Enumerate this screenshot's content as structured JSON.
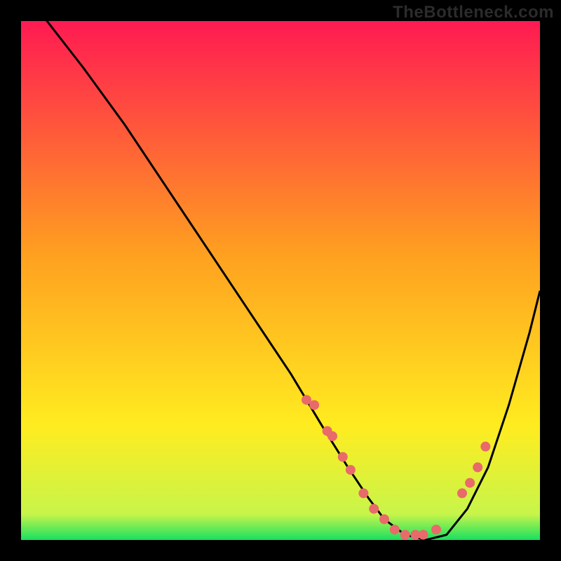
{
  "watermark": "TheBottleneck.com",
  "colors": {
    "frame": "#000000",
    "gradient_top": "#ff1a52",
    "gradient_mid_upper": "#ffa020",
    "gradient_mid_lower": "#ffec20",
    "gradient_green": "#18e060",
    "curve": "#000000",
    "marker": "#e86a6a"
  },
  "chart_data": {
    "type": "line",
    "title": "",
    "xlabel": "",
    "ylabel": "",
    "xlim": [
      0,
      100
    ],
    "ylim": [
      0,
      100
    ],
    "curve": {
      "x": [
        0,
        5,
        12,
        20,
        28,
        36,
        44,
        52,
        58,
        63,
        67,
        70,
        74,
        78,
        82,
        86,
        90,
        94,
        98,
        100
      ],
      "y": [
        110,
        100,
        91,
        80,
        68,
        56,
        44,
        32,
        22,
        14,
        8,
        4,
        1,
        0,
        1,
        6,
        14,
        26,
        40,
        48
      ]
    },
    "markers": {
      "x": [
        55,
        56.5,
        59,
        60,
        62,
        63.5,
        66,
        68,
        70,
        72,
        74,
        76,
        77.5,
        80,
        85,
        86.5,
        88,
        89.5
      ],
      "y": [
        27,
        26,
        21,
        20,
        16,
        13.5,
        9,
        6,
        4,
        2,
        1,
        1,
        1,
        2,
        9,
        11,
        14,
        18
      ]
    }
  }
}
